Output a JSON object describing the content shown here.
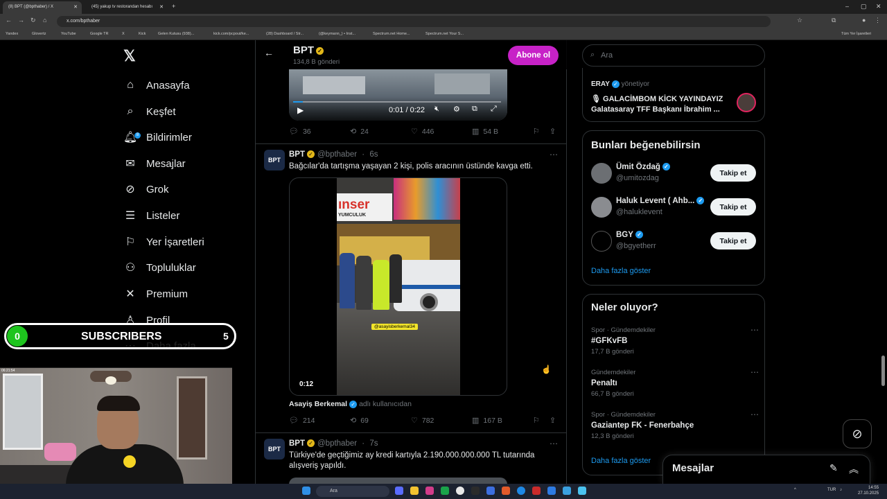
{
  "browser": {
    "tabs": [
      {
        "label": "(8) BPT (@bpthaber) / X"
      },
      {
        "label": "(45) yakup tv restorandan hesabı"
      }
    ],
    "url": "x.com/bpthaber",
    "bookmarks": [
      "Yandex",
      "Glovertz",
      "YouTube",
      "Google TR",
      "X",
      "Kick",
      "Gelen Kutusu (938)...",
      "kick.com/pcpout/ke...",
      "(28) Dashboard / Str...",
      "(@keymann_) • Inst...",
      "Spectrum.net Home...",
      "Spectrum.net Your S..."
    ],
    "bookmarks_right": "Tüm Yer İşaretleri"
  },
  "nav": {
    "items": [
      {
        "label": "Anasayfa",
        "icon": "home-icon"
      },
      {
        "label": "Keşfet",
        "icon": "search-icon"
      },
      {
        "label": "Bildirimler",
        "icon": "bell-icon",
        "badge": "8"
      },
      {
        "label": "Mesajlar",
        "icon": "mail-icon"
      },
      {
        "label": "Grok",
        "icon": "grok-icon"
      },
      {
        "label": "Listeler",
        "icon": "list-icon"
      },
      {
        "label": "Yer İşaretleri",
        "icon": "bookmark-icon"
      },
      {
        "label": "Topluluklar",
        "icon": "communities-icon"
      },
      {
        "label": "Premium",
        "icon": "x-icon"
      },
      {
        "label": "Profil",
        "icon": "profile-icon"
      },
      {
        "label": "Daha fazla",
        "icon": "more-icon"
      }
    ]
  },
  "profile_header": {
    "name": "BPT",
    "post_count": "134,8 B gönderi",
    "subscribe_label": "Abone ol"
  },
  "tweet1": {
    "video_time": "0:01 / 0:22",
    "video_progress": 0.045,
    "stats": {
      "replies": "36",
      "reposts": "24",
      "likes": "446",
      "views": "54 B"
    }
  },
  "tweet2": {
    "name": "BPT",
    "handle": "@bpthaber",
    "time": "6s",
    "text": "Bağcılar'da tartışma yaşayan 2 kişi, polis aracının üstünde kavga etti.",
    "video_sign": "ınser",
    "video_sign_sub": "YUMCULUK",
    "video_watermark": "@asayisberkemal34",
    "video_time": "0:12",
    "via_name": "Asayiş Berkemal",
    "via_suffix": "adlı kullanıcıdan",
    "stats": {
      "replies": "214",
      "reposts": "69",
      "likes": "782",
      "views": "167 B"
    }
  },
  "tweet3": {
    "name": "BPT",
    "handle": "@bpthaber",
    "time": "7s",
    "text": "Türkiye'de geçtiğimiz ay kredi kartıyla 2.190.000.000.000 TL tutarında alışveriş yapıldı."
  },
  "right": {
    "search_placeholder": "Ara",
    "live": {
      "host": "ERAY",
      "host_suffix": "yönetiyor",
      "title": "🎙 GALACİMBOM KİCK YAYINDAYIZ",
      "subtitle": "Galatasaray TFF Başkanı İbrahim ..."
    },
    "who_to_follow": {
      "title": "Bunları beğenebilirsin",
      "users": [
        {
          "name": "Ümit Özdağ",
          "handle": "@umitozdag",
          "button": "Takip et"
        },
        {
          "name": "Haluk Levent ( Ahb...",
          "handle": "@haluklevent",
          "button": "Takip et"
        },
        {
          "name": "BGY",
          "handle": "@bgyetherr",
          "button": "Takip et"
        }
      ],
      "show_more": "Daha fazla göster"
    },
    "trends": {
      "title": "Neler oluyor?",
      "items": [
        {
          "category": "Spor · Gündemdekiler",
          "title": "#GFKvFB",
          "count": "17,7 B gönderi"
        },
        {
          "category": "Gündemdekiler",
          "title": "Penaltı",
          "count": "66,7 B gönderi"
        },
        {
          "category": "Spor · Gündemdekiler",
          "title": "Gaziantep FK - Fenerbahçe",
          "count": "12,3 B gönderi"
        }
      ],
      "show_more": "Daha fazla göster"
    }
  },
  "messages_drawer": {
    "title": "Mesajlar"
  },
  "overlay": {
    "subscribers_label": "SUBSCRIBERS",
    "left_count": "0",
    "right_count": "5"
  },
  "webcam": {
    "stamp": "06:21:54"
  },
  "taskbar": {
    "search": "Ara",
    "lang": "TUR",
    "time": "14:55",
    "date": "27.10.2025"
  }
}
